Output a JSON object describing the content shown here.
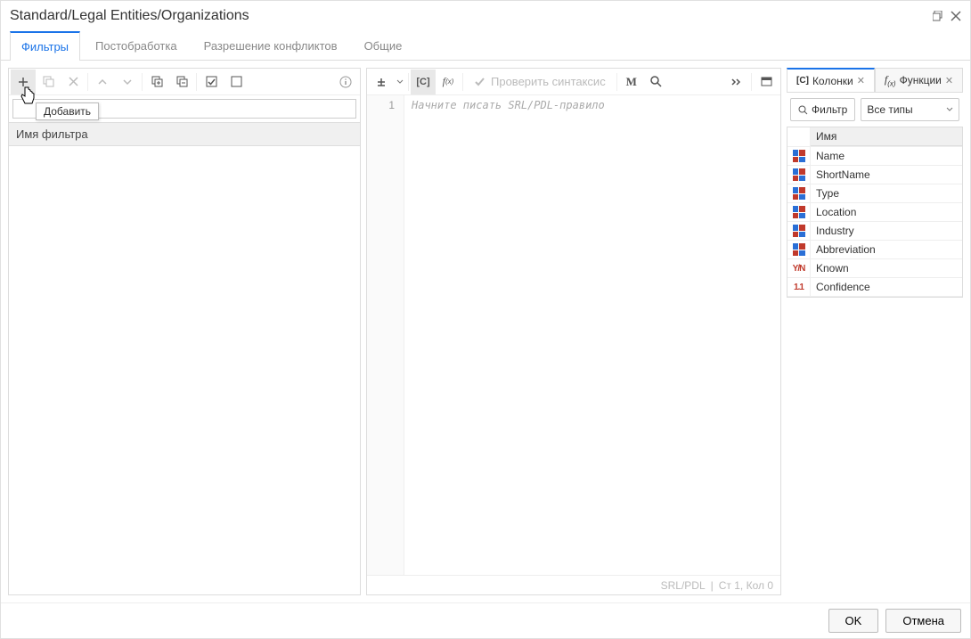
{
  "title": "Standard/Legal Entities/Organizations",
  "tabs": [
    {
      "label": "Фильтры",
      "active": true
    },
    {
      "label": "Постобработка",
      "active": false
    },
    {
      "label": "Разрешение конфликтов",
      "active": false
    },
    {
      "label": "Общие",
      "active": false
    }
  ],
  "left": {
    "add_tooltip": "Добавить",
    "search_value": "",
    "list_header": "Имя фильтра"
  },
  "editor": {
    "line_no": "1",
    "placeholder": "Начните писать SRL/PDL-правило",
    "check_label": "Проверить синтаксис",
    "status_lang": "SRL/PDL",
    "status_pos": "Ст 1, Кол 0"
  },
  "right": {
    "tabs": [
      {
        "label": "Колонки",
        "active": true,
        "prefix": "[C]"
      },
      {
        "label": "Функции",
        "active": false,
        "prefix": "f(x)"
      }
    ],
    "filter_label": "Фильтр",
    "type_select": "Все типы",
    "table_header": "Имя",
    "columns": [
      {
        "name": "Name",
        "kind": "field"
      },
      {
        "name": "ShortName",
        "kind": "field"
      },
      {
        "name": "Type",
        "kind": "field"
      },
      {
        "name": "Location",
        "kind": "field"
      },
      {
        "name": "Industry",
        "kind": "field"
      },
      {
        "name": "Abbreviation",
        "kind": "field"
      },
      {
        "name": "Known",
        "kind": "bool"
      },
      {
        "name": "Confidence",
        "kind": "num"
      }
    ]
  },
  "footer": {
    "ok": "OK",
    "cancel": "Отмена"
  }
}
